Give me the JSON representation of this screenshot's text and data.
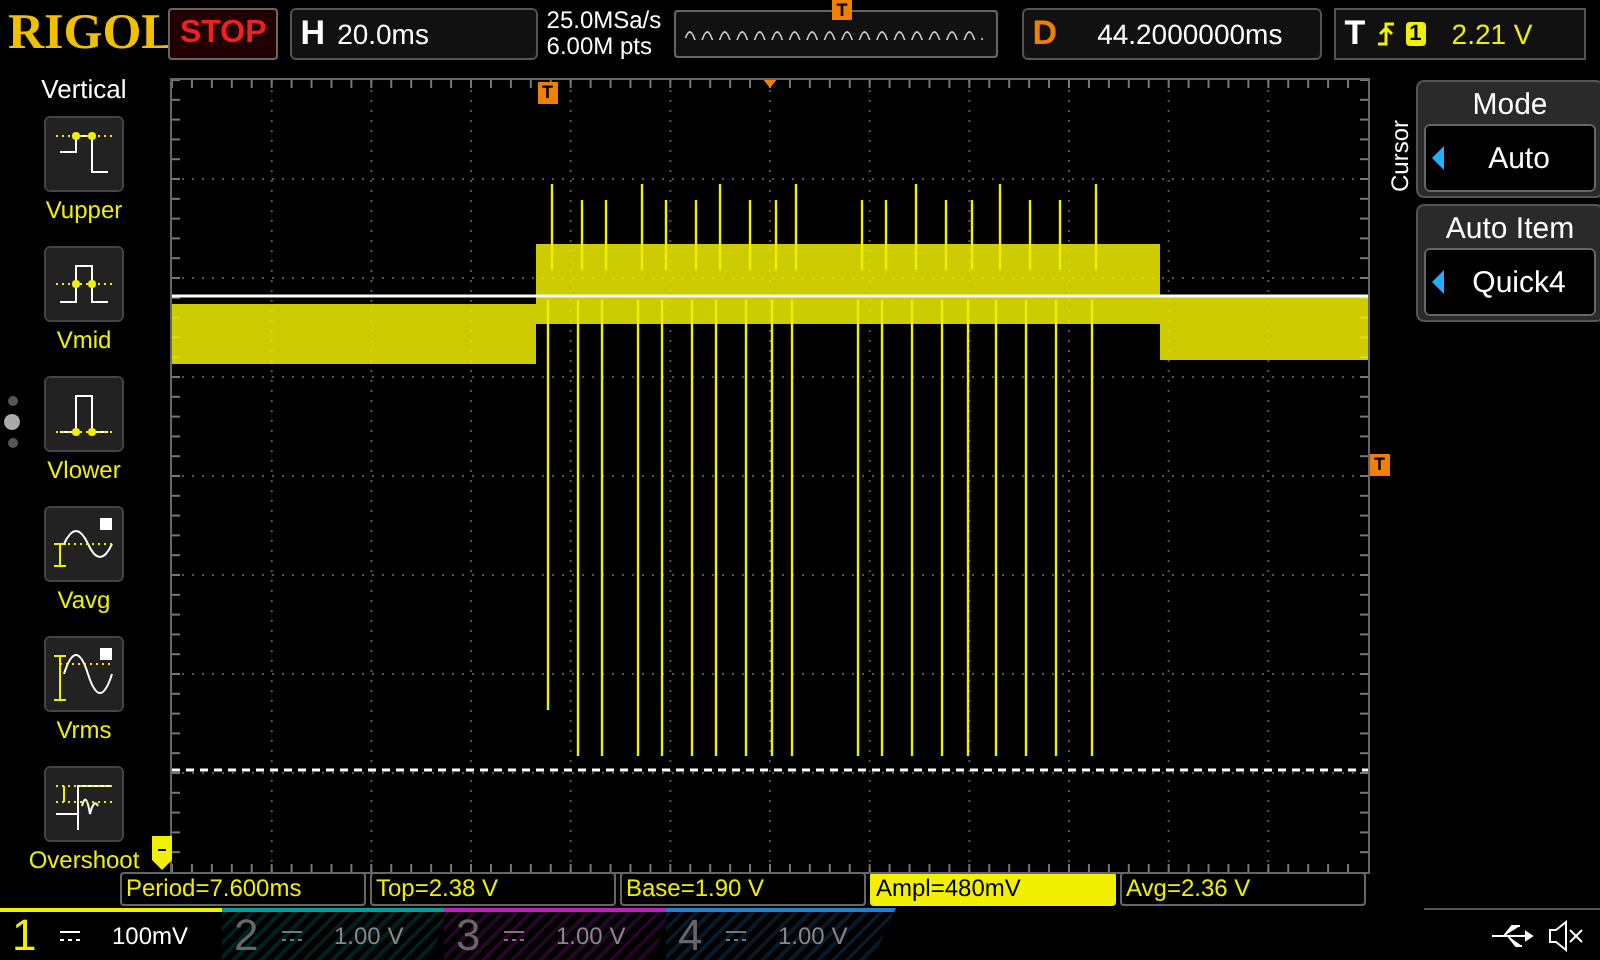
{
  "header": {
    "brand": "RIGOL",
    "run_state": "STOP",
    "horizontal": {
      "label": "H",
      "timebase": "20.0ms"
    },
    "sample_rate": "25.0MSa/s",
    "memory_depth": "6.00M pts",
    "trigger_position_marker": "T",
    "delay": {
      "label": "D",
      "value": "44.2000000ms"
    },
    "trigger": {
      "label": "T",
      "channel": "1",
      "level": "2.21 V"
    }
  },
  "left_menu": {
    "title": "Vertical",
    "pages": [
      {
        "selected": false
      },
      {
        "selected": true
      },
      {
        "selected": false
      }
    ],
    "items": [
      {
        "kind": "vupper",
        "label": "Vupper"
      },
      {
        "kind": "vmid",
        "label": "Vmid"
      },
      {
        "kind": "vlower",
        "label": "Vlower"
      },
      {
        "kind": "vavg",
        "label": "Vavg"
      },
      {
        "kind": "vrms",
        "label": "Vrms"
      },
      {
        "kind": "overshoot",
        "label": "Overshoot"
      }
    ]
  },
  "display": {
    "trigger_time_marker": "T",
    "trigger_level_marker": "T"
  },
  "right_menu": {
    "title": "Cursor",
    "items": [
      {
        "label": "Mode",
        "value": "Auto"
      },
      {
        "label": "Auto Item",
        "value": "Quick4"
      }
    ]
  },
  "measurements": [
    {
      "text": "Period=7.600ms",
      "selected": false
    },
    {
      "text": "Top=2.38 V",
      "selected": false
    },
    {
      "text": "Base=1.90 V",
      "selected": false
    },
    {
      "text": "Ampl=480mV",
      "selected": true
    },
    {
      "text": "Avg=2.36 V",
      "selected": false
    }
  ],
  "channels": [
    {
      "number": "1",
      "scale": "100mV",
      "on": true,
      "color": "#f0f000"
    },
    {
      "number": "2",
      "scale": "1.00 V",
      "on": false,
      "color": "#00a0a0"
    },
    {
      "number": "3",
      "scale": "1.00 V",
      "on": false,
      "color": "#c020c0"
    },
    {
      "number": "4",
      "scale": "1.00 V",
      "on": false,
      "color": "#2080d0"
    }
  ]
}
